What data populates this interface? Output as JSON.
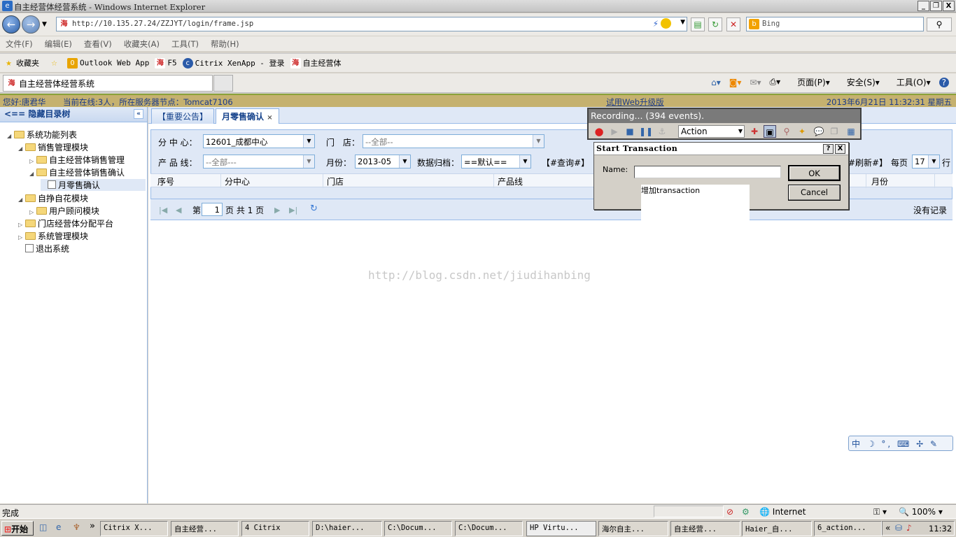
{
  "window": {
    "title": "自主经营体经营系统 - Windows Internet Explorer",
    "min": "_",
    "max": "❐",
    "close": "X"
  },
  "nav": {
    "back": "←",
    "forward": "→",
    "url": "http://10.135.27.24/ZZJYT/login/frame.jsp",
    "url_favicon": "海",
    "search_placeholder": "Bing",
    "search_go": "⚲"
  },
  "menu": [
    "文件(F)",
    "编辑(E)",
    "查看(V)",
    "收藏夹(A)",
    "工具(T)",
    "帮助(H)"
  ],
  "favorites": {
    "label": "收藏夹",
    "items": [
      "Outlook Web App",
      "F5",
      "Citrix XenApp - 登录",
      "自主经营体"
    ]
  },
  "tab": {
    "title": "自主经营体经营系统"
  },
  "commandbar": {
    "page": "页面(P)",
    "safety": "安全(S)",
    "tools": "工具(O)",
    "help": "?"
  },
  "infobar": {
    "greeting": "您好:唐君华",
    "online": "当前在线:3人，所在服务器节点：Tomcat7106",
    "upgrade": "试用Web升级版",
    "datetime": "2013年6月21日 11:32:31 星期五"
  },
  "sidebar": {
    "title": "<== 隐藏目录树",
    "collapse": "«",
    "tree": [
      "系统功能列表",
      "销售管理模块",
      "自主经营体销售管理",
      "自主经营体销售确认",
      "月零售确认",
      "自挣自花模块",
      "用户顾问模块",
      "门店经营体分配平台",
      "系统管理模块",
      "退出系统"
    ]
  },
  "tabs": [
    {
      "label": "【重要公告】"
    },
    {
      "label": "月零售确认",
      "close": "×"
    }
  ],
  "form": {
    "branch_label": "分 中 心：",
    "branch_value": "12601_成都中心",
    "store_label": "门　店：",
    "store_value": "--全部--",
    "product_label": "产 品 线：",
    "product_value": "--全部---",
    "month_label": "月份：",
    "month_value": "2013-05",
    "archive_label": "数据归档：",
    "archive_value": "==默认==",
    "query_button": "【#查询#】",
    "refresh_button": "#刷新#】",
    "perpage_label": "每页",
    "perpage_value": "17",
    "perpage_unit": "行"
  },
  "grid": {
    "headers": [
      "序号",
      "分中心",
      "门店",
      "产品线",
      "月份"
    ]
  },
  "pager": {
    "page_label": "第",
    "page_value": "1",
    "total": "页 共 1 页",
    "empty": "没有记录"
  },
  "watermark": "http://blog.csdn.net/jiudihanbing",
  "recorder": {
    "title": "Recording... (394 events).",
    "action": "Action"
  },
  "dialog": {
    "title": "Start Transaction",
    "help": "?",
    "close": "X",
    "name_label": "Name:",
    "name_value": "",
    "ok": "OK",
    "cancel": "Cancel",
    "suggestion": "增加transaction"
  },
  "ime": "中 ☽ °, ⌨ ✢ ✎",
  "status": {
    "done": "完成",
    "zone": "Internet",
    "zoom": "100%"
  },
  "taskbar": {
    "start": "开始",
    "tasks": [
      "Citrix X...",
      "自主经营...",
      "4 Citrix",
      "D:\\haier...",
      "C:\\Docum...",
      "C:\\Docum...",
      "HP Virtu...",
      "海尔自主...",
      "自主经营...",
      "Haier_自...",
      "6_action..."
    ],
    "time": "11:32"
  }
}
